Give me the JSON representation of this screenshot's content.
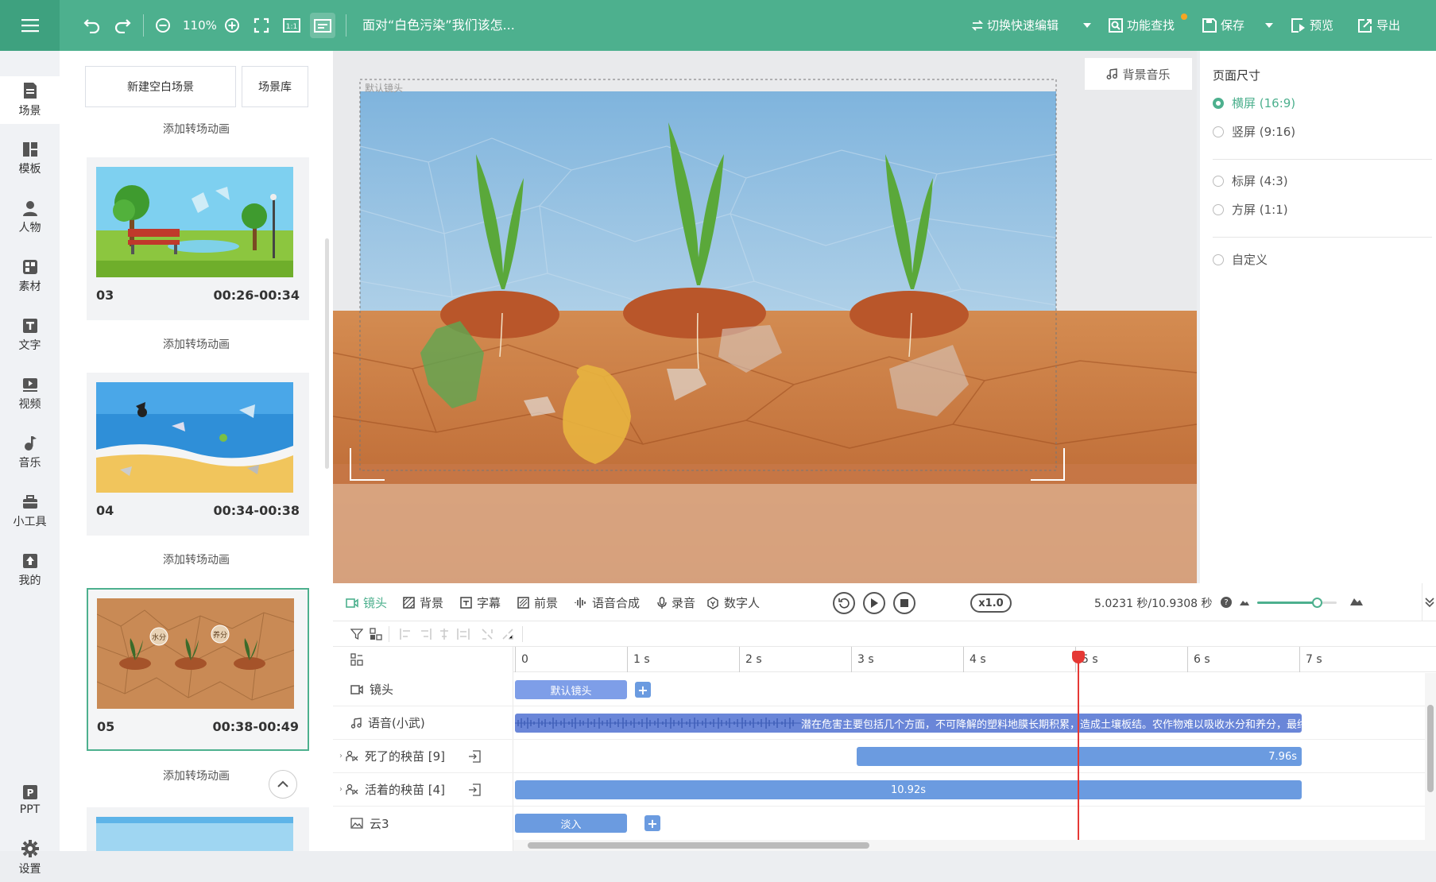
{
  "topbar": {
    "zoom": "110%",
    "doc_title": "面对“白色污染”我们该怎...",
    "switch_edit": "切换快速编辑",
    "find": "功能查找",
    "save": "保存",
    "preview": "预览",
    "export": "导出",
    "colors": {
      "bar": "#4db08e",
      "menu_bg": "#3ea17f",
      "notify_dot": "#f5a623"
    }
  },
  "nav": {
    "items": [
      {
        "label": "场景",
        "icon": "scene-icon"
      },
      {
        "label": "模板",
        "icon": "template-icon"
      },
      {
        "label": "人物",
        "icon": "person-icon"
      },
      {
        "label": "素材",
        "icon": "material-icon"
      },
      {
        "label": "文字",
        "icon": "text-icon"
      },
      {
        "label": "视频",
        "icon": "video-icon"
      },
      {
        "label": "音乐",
        "icon": "music-icon"
      },
      {
        "label": "小工具",
        "icon": "toolbox-icon"
      },
      {
        "label": "我的",
        "icon": "upload-icon"
      }
    ],
    "ppt": "PPT",
    "settings": "设置"
  },
  "scenes": {
    "new_blank": "新建空白场景",
    "library": "场景库",
    "transition": "添加转场动画",
    "cards": [
      {
        "num": "03",
        "time": "00:26-00:34"
      },
      {
        "num": "04",
        "time": "00:34-00:38"
      },
      {
        "num": "05",
        "time": "00:38-00:49"
      }
    ],
    "thumb05_labels": [
      "水分",
      "养分"
    ]
  },
  "stage": {
    "bg_music": "背景音乐",
    "camera_label": "默认镜头"
  },
  "page_size": {
    "title": "页面尺寸",
    "options": [
      {
        "label": "横屏  (16:9)",
        "selected": true
      },
      {
        "label": "竖屏  (9:16)",
        "selected": false
      },
      {
        "label": "标屏  (4:3)",
        "selected": false
      },
      {
        "label": "方屏  (1:1)",
        "selected": false
      },
      {
        "label": "自定义",
        "selected": false
      }
    ]
  },
  "timeline": {
    "tabs": [
      "镜头",
      "背景",
      "字幕",
      "前景",
      "语音合成",
      "录音",
      "数字人"
    ],
    "speed": "x1.0",
    "time_readout": "5.0231 秒/10.9308 秒",
    "ruler": [
      "0",
      "1 s",
      "2 s",
      "3 s",
      "4 s",
      "5 s",
      "6 s",
      "7 s"
    ],
    "playhead_seconds": 5.0231,
    "zoom_level": 0.75,
    "tracks": [
      {
        "label": "镜头",
        "icon": "camera-icon"
      },
      {
        "label": "语音(小武)",
        "icon": "music-note-icon"
      },
      {
        "label": "死了的秧苗 [9]",
        "icon": "character-icon"
      },
      {
        "label": "活着的秧苗 [4]",
        "icon": "character-icon"
      },
      {
        "label": "云3",
        "icon": "image-icon"
      }
    ],
    "clips": {
      "camera": "默认镜头",
      "voice": "潜在危害主要包括几个方面，不可降解的塑料地膜长期积累，造成土壤板结。农作物难以吸收水分和养分，最终",
      "dead": "7.96s",
      "alive": "10.92s",
      "cloud": "淡入"
    }
  }
}
